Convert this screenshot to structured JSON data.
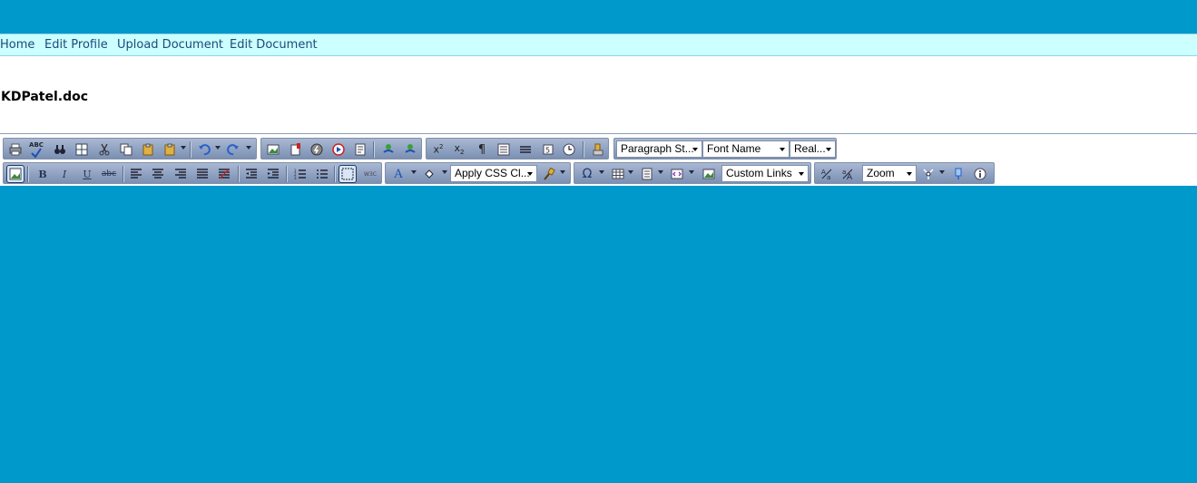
{
  "nav": {
    "items": [
      {
        "label": "Home"
      },
      {
        "label": "Edit Profile"
      },
      {
        "label": "Upload Document"
      },
      {
        "label": "Edit Document"
      }
    ]
  },
  "document": {
    "title": "KDPatel.doc"
  },
  "toolbar": {
    "paragraph_style": "Paragraph St...",
    "font_name": "Font Name",
    "font_size": "Real...",
    "apply_css": "Apply CSS Cl...",
    "custom_links": "Custom Links",
    "zoom": "Zoom",
    "special_glyphs": {
      "omega": "Ω",
      "bold": "B",
      "italic": "I",
      "underline": "U",
      "strike": "abc",
      "spell": "ABC",
      "w3c": "W3C",
      "font_color": "A",
      "paragraph": "¶"
    }
  },
  "colors": {
    "top_bar": "#0099cc",
    "nav_bg": "#ccffff",
    "nav_link": "#1a4a7a",
    "editor_bg": "#0099cc"
  }
}
